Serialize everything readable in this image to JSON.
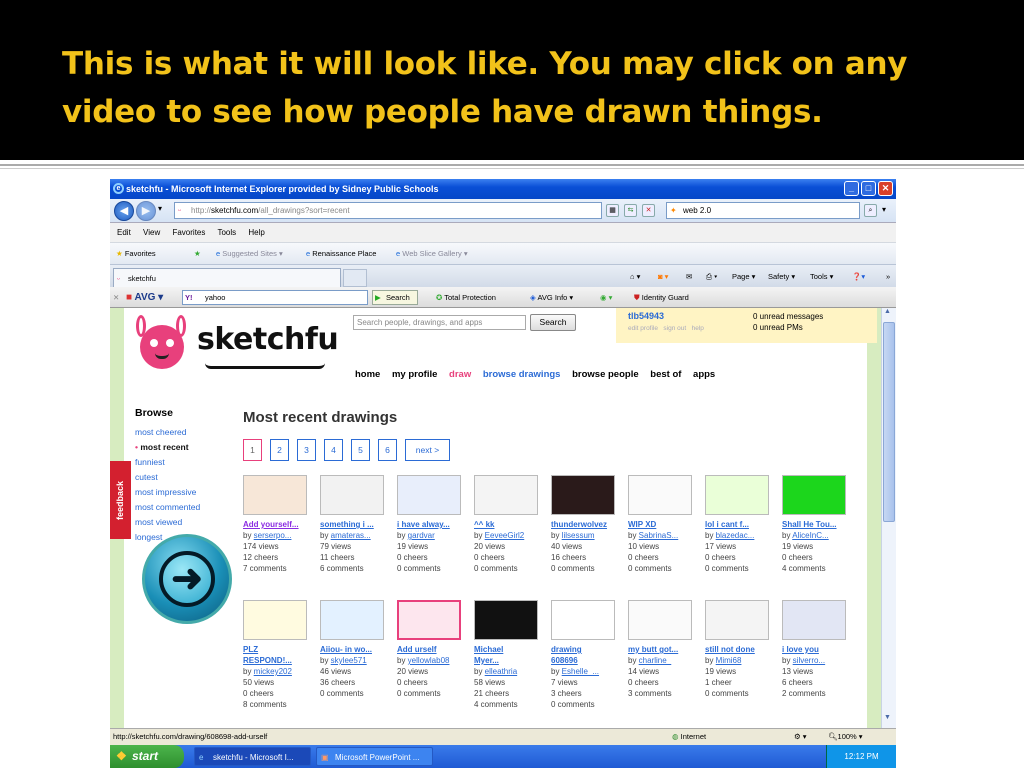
{
  "slide": {
    "title": "This is what it will look like. You may click on any video to see how people have drawn things."
  },
  "browser": {
    "window_title": "sketchfu - Microsoft Internet Explorer provided by Sidney Public Schools",
    "address_prefix": "http://",
    "address_host": "sketchfu.com",
    "address_path": "/all_drawings?sort=recent",
    "search_value": "web 2.0",
    "menu": [
      "Edit",
      "View",
      "Favorites",
      "Tools",
      "Help"
    ],
    "favorites_label": "Favorites",
    "favbar_items": [
      "Suggested Sites ▾",
      "Renaissance Place",
      "Web Slice Gallery ▾"
    ],
    "tab_label": "sketchfu",
    "commands": [
      "Page ▾",
      "Safety ▾",
      "Tools ▾"
    ],
    "avg_label": "AVG",
    "avg_search_value": "yahoo",
    "avg_search_btn": "Search",
    "avg_items": [
      "Total Protection",
      "AVG Info ▾",
      "Identity Guard"
    ],
    "status_url": "http://sketchfu.com/drawing/608698-add-urself",
    "status_zone": "Internet",
    "zoom": "100%"
  },
  "site": {
    "logo_text": "sketchfu",
    "search_placeholder": "Search people, drawings, and apps",
    "search_btn": "Search",
    "user": {
      "name": "tlb54943",
      "links": "edit profile   sign out   help",
      "messages": "0 unread messages",
      "pms": "0 unread PMs"
    },
    "nav": [
      "home",
      "my profile",
      "draw",
      "browse drawings",
      "browse people",
      "best of",
      "apps"
    ],
    "browse_heading": "Browse",
    "browse_items": [
      "most cheered",
      "most recent",
      "funniest",
      "cutest",
      "most impressive",
      "most commented",
      "most viewed",
      "longest"
    ],
    "feedback": "feedback",
    "heading": "Most recent drawings",
    "pages": [
      "1",
      "2",
      "3",
      "4",
      "5",
      "6"
    ],
    "next": "next >",
    "drawings": [
      {
        "title": "Add yourself...",
        "by": "serserpo...",
        "views": "174 views",
        "cheers": "12 cheers",
        "comments": "7 comments",
        "visited": true
      },
      {
        "title": "something i ...",
        "by": "amateras...",
        "views": "79 views",
        "cheers": "11 cheers",
        "comments": "6 comments"
      },
      {
        "title": "i have alway...",
        "by": "gardvar",
        "views": "19 views",
        "cheers": "0 cheers",
        "comments": "0 comments"
      },
      {
        "title": "^^ kk",
        "by": "EeveeGirl2",
        "views": "20 views",
        "cheers": "0 cheers",
        "comments": "0 comments"
      },
      {
        "title": "thunderwolvez",
        "by": "lilsessum",
        "views": "40 views",
        "cheers": "16 cheers",
        "comments": "0 comments"
      },
      {
        "title": "WIP XD",
        "by": "SabrinaS...",
        "views": "10 views",
        "cheers": "0 cheers",
        "comments": "0 comments"
      },
      {
        "title": "lol i cant f...",
        "by": "blazedac...",
        "views": "17 views",
        "cheers": "0 cheers",
        "comments": "0 comments"
      },
      {
        "title": "Shall He Tou...",
        "by": "AliceInC...",
        "views": "19 views",
        "cheers": "0 cheers",
        "comments": "4 comments"
      },
      {
        "title": "PLZ",
        "title2": "RESPOND!...",
        "by": "mickey202",
        "views": "50 views",
        "cheers": "0 cheers",
        "comments": "8 comments"
      },
      {
        "title": "Aiiou- in wo...",
        "by": "skylee571",
        "views": "46 views",
        "cheers": "36 cheers",
        "comments": "0 comments"
      },
      {
        "title": "Add urself",
        "by": "yellowlab08",
        "views": "20 views",
        "cheers": "0 cheers",
        "comments": "0 comments"
      },
      {
        "title": "Michael",
        "title2": "Myer...",
        "by": "elleathria",
        "views": "58 views",
        "cheers": "21 cheers",
        "comments": "4 comments"
      },
      {
        "title": "drawing",
        "title2": "608696",
        "by": "Eshelle_...",
        "views": "7 views",
        "cheers": "3 cheers",
        "comments": "0 comments"
      },
      {
        "title": "my butt got...",
        "by": "charline_",
        "views": "14 views",
        "cheers": "0 cheers",
        "comments": "3 comments"
      },
      {
        "title": "still not done",
        "by": "Mimi68",
        "views": "19 views",
        "cheers": "1 cheer",
        "comments": "0 comments"
      },
      {
        "title": "i love you",
        "by": "silverro...",
        "views": "13 views",
        "cheers": "6 cheers",
        "comments": "2 comments"
      }
    ]
  },
  "taskbar": {
    "start": "start",
    "tasks": [
      "sketchfu - Microsoft I...",
      "Microsoft PowerPoint ..."
    ],
    "clock": "12:12 PM"
  },
  "colors": {
    "slide_title": "#f2c21a",
    "brand_pink": "#e8407c",
    "link_blue": "#2b6bd5"
  }
}
